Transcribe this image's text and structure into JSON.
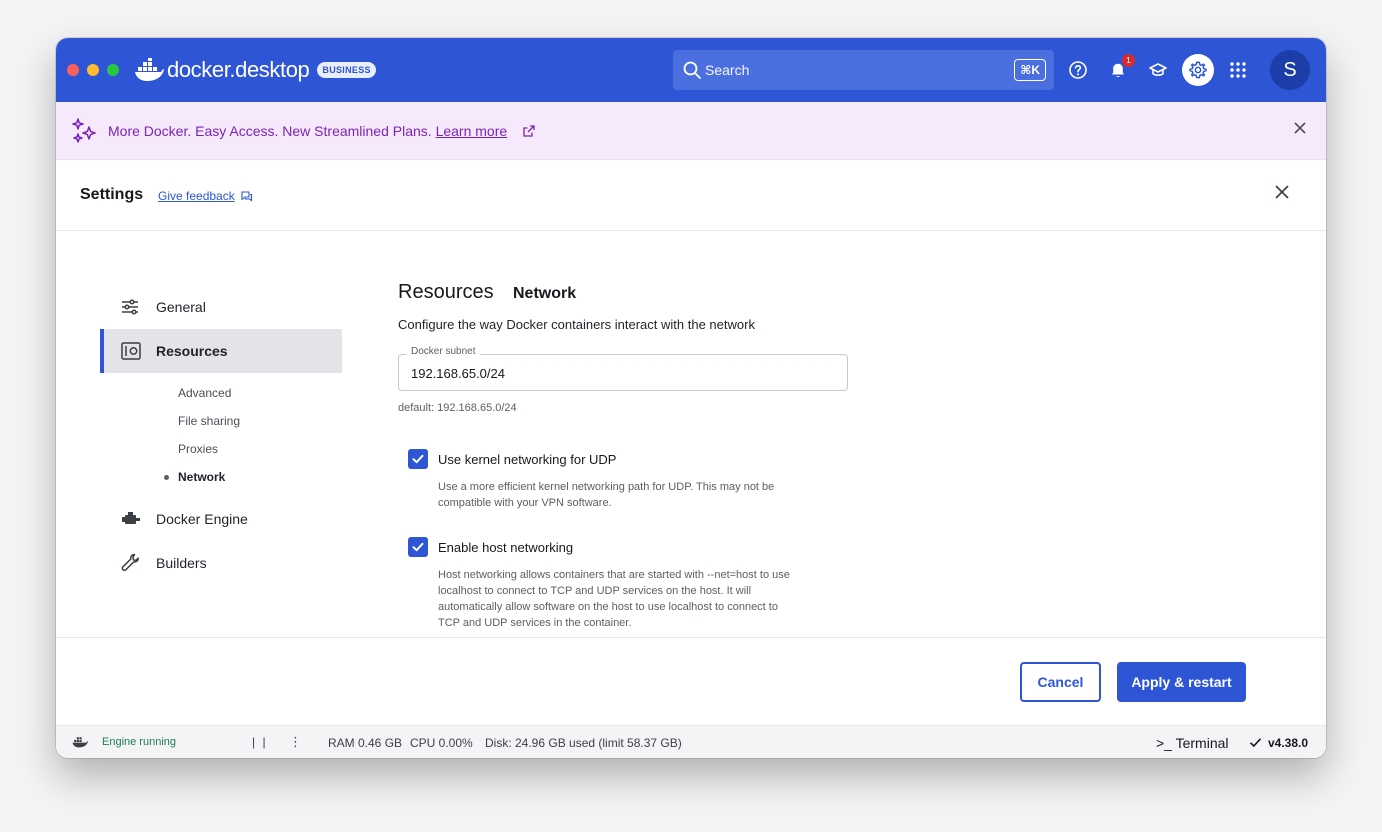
{
  "titlebar": {
    "brand": "docker.desktop",
    "badge": "BUSINESS",
    "search_placeholder": "Search",
    "search_shortcut": "⌘K",
    "notification_count": "1",
    "avatar_initial": "S",
    "background_color": "#2e55d6"
  },
  "promo": {
    "text": "More Docker. Easy Access. New Streamlined Plans.",
    "link": "Learn more",
    "text_color": "#7a23b8"
  },
  "settings": {
    "title": "Settings",
    "feedback": "Give feedback"
  },
  "sidebar": {
    "items": [
      {
        "label": "General",
        "icon": "sliders-icon"
      },
      {
        "label": "Resources",
        "icon": "resources-icon"
      },
      {
        "label": "Docker Engine",
        "icon": "engine-icon"
      },
      {
        "label": "Builders",
        "icon": "wrench-icon"
      }
    ],
    "sub_items": [
      "Advanced",
      "File sharing",
      "Proxies",
      "Network"
    ],
    "active_item": "Resources",
    "active_sub_item": "Network"
  },
  "main": {
    "section": "Resources",
    "subsection": "Network",
    "description": "Configure the way Docker containers interact with the network",
    "subnet": {
      "label": "Docker subnet",
      "value": "192.168.65.0/24",
      "helper": "default: 192.168.65.0/24"
    },
    "options": [
      {
        "label": "Use kernel networking for UDP",
        "checked": true,
        "help_lines": [
          "Use a more efficient kernel networking path for UDP. This may not be",
          "compatible with your VPN software."
        ]
      },
      {
        "label": "Enable host networking",
        "checked": true,
        "help_lines": [
          "Host networking allows containers that are started with --net=host to use",
          "localhost to connect to TCP and UDP services on the host. It will",
          "automatically allow software on the host to use localhost to connect to",
          "TCP and UDP services in the container."
        ]
      }
    ]
  },
  "footer": {
    "cancel": "Cancel",
    "apply": "Apply & restart"
  },
  "statusbar": {
    "engine": "Engine running",
    "pause": "| |",
    "more": "⋮",
    "ram": "RAM 0.46 GB",
    "cpu": "CPU 0.00%",
    "disk": "Disk: 24.96 GB used (limit 58.37 GB)",
    "terminal": ">_ Terminal",
    "version": "v4.38.0"
  }
}
